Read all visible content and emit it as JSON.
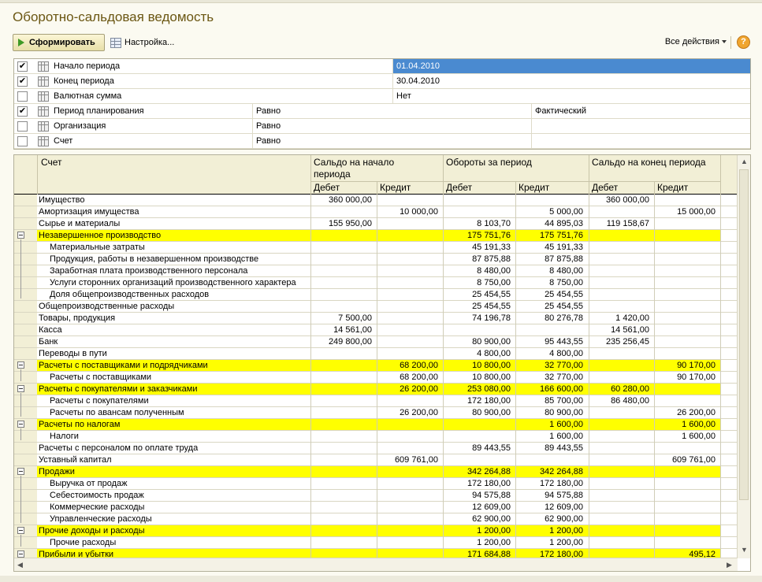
{
  "window": {
    "title": "Оборотно-сальдовая ведомость"
  },
  "toolbar": {
    "generate_label": "Сформировать",
    "settings_label": "Настройка...",
    "all_actions_label": "Все действия",
    "help_label": "?"
  },
  "settings": [
    {
      "checked": true,
      "name": "Начало периода",
      "condition": "",
      "value": "01.04.2010",
      "value2": ""
    },
    {
      "checked": true,
      "name": "Конец периода",
      "condition": "",
      "value": "30.04.2010",
      "value2": ""
    },
    {
      "checked": false,
      "name": "Валютная сумма",
      "condition": "",
      "value": "Нет",
      "value2": ""
    },
    {
      "checked": true,
      "name": "Период планирования",
      "condition": "Равно",
      "value": "",
      "value2": "Фактический"
    },
    {
      "checked": false,
      "name": "Организация",
      "condition": "Равно",
      "value": "",
      "value2": ""
    },
    {
      "checked": false,
      "name": "Счет",
      "condition": "Равно",
      "value": "",
      "value2": ""
    }
  ],
  "report": {
    "headers": {
      "account": "Счет",
      "opening": "Сальдо на начало периода",
      "turnover": "Обороты за период",
      "closing": "Сальдо на конец периода",
      "debit": "Дебет",
      "credit": "Кредит"
    },
    "rows": [
      {
        "name": "Имущество",
        "level": 0,
        "hl": false,
        "group": false,
        "v": [
          "360 000,00",
          "",
          "",
          "",
          "360 000,00",
          ""
        ]
      },
      {
        "name": "Амортизация имущества",
        "level": 0,
        "hl": false,
        "group": false,
        "v": [
          "",
          "10 000,00",
          "",
          "5 000,00",
          "",
          "15 000,00"
        ]
      },
      {
        "name": "Сырье и материалы",
        "level": 0,
        "hl": false,
        "group": false,
        "v": [
          "155 950,00",
          "",
          "8 103,70",
          "44 895,03",
          "119 158,67",
          ""
        ]
      },
      {
        "name": "Незавершенное производство",
        "level": 0,
        "hl": true,
        "group": true,
        "v": [
          "",
          "",
          "175 751,76",
          "175 751,76",
          "",
          ""
        ]
      },
      {
        "name": "Материальные затраты",
        "level": 1,
        "hl": false,
        "group": false,
        "v": [
          "",
          "",
          "45 191,33",
          "45 191,33",
          "",
          ""
        ]
      },
      {
        "name": "Продукция, работы в незавершенном производстве",
        "level": 1,
        "hl": false,
        "group": false,
        "v": [
          "",
          "",
          "87 875,88",
          "87 875,88",
          "",
          ""
        ]
      },
      {
        "name": "Заработная плата производственного персонала",
        "level": 1,
        "hl": false,
        "group": false,
        "v": [
          "",
          "",
          "8 480,00",
          "8 480,00",
          "",
          ""
        ]
      },
      {
        "name": "Услуги сторонних организаций производственного характера",
        "level": 1,
        "hl": false,
        "group": false,
        "v": [
          "",
          "",
          "8 750,00",
          "8 750,00",
          "",
          ""
        ]
      },
      {
        "name": "Доля общепроизводственных расходов",
        "level": 1,
        "hl": false,
        "group": false,
        "v": [
          "",
          "",
          "25 454,55",
          "25 454,55",
          "",
          ""
        ]
      },
      {
        "name": "Общепроизводственные расходы",
        "level": 0,
        "hl": false,
        "group": false,
        "v": [
          "",
          "",
          "25 454,55",
          "25 454,55",
          "",
          ""
        ]
      },
      {
        "name": "Товары, продукция",
        "level": 0,
        "hl": false,
        "group": false,
        "v": [
          "7 500,00",
          "",
          "74 196,78",
          "80 276,78",
          "1 420,00",
          ""
        ]
      },
      {
        "name": "Касса",
        "level": 0,
        "hl": false,
        "group": false,
        "v": [
          "14 561,00",
          "",
          "",
          "",
          "14 561,00",
          ""
        ]
      },
      {
        "name": "Банк",
        "level": 0,
        "hl": false,
        "group": false,
        "v": [
          "249 800,00",
          "",
          "80 900,00",
          "95 443,55",
          "235 256,45",
          ""
        ]
      },
      {
        "name": "Переводы в пути",
        "level": 0,
        "hl": false,
        "group": false,
        "v": [
          "",
          "",
          "4 800,00",
          "4 800,00",
          "",
          ""
        ]
      },
      {
        "name": "Расчеты с поставщиками и подрядчиками",
        "level": 0,
        "hl": true,
        "group": true,
        "v": [
          "",
          "68 200,00",
          "10 800,00",
          "32 770,00",
          "",
          "90 170,00"
        ]
      },
      {
        "name": "Расчеты с поставщиками",
        "level": 1,
        "hl": false,
        "group": false,
        "v": [
          "",
          "68 200,00",
          "10 800,00",
          "32 770,00",
          "",
          "90 170,00"
        ]
      },
      {
        "name": "Расчеты с покупателями и заказчиками",
        "level": 0,
        "hl": true,
        "group": true,
        "v": [
          "",
          "26 200,00",
          "253 080,00",
          "166 600,00",
          "60 280,00",
          ""
        ]
      },
      {
        "name": "Расчеты с покупателями",
        "level": 1,
        "hl": false,
        "group": false,
        "v": [
          "",
          "",
          "172 180,00",
          "85 700,00",
          "86 480,00",
          ""
        ]
      },
      {
        "name": "Расчеты по авансам полученным",
        "level": 1,
        "hl": false,
        "group": false,
        "v": [
          "",
          "26 200,00",
          "80 900,00",
          "80 900,00",
          "",
          "26 200,00"
        ]
      },
      {
        "name": "Расчеты по налогам",
        "level": 0,
        "hl": true,
        "group": true,
        "v": [
          "",
          "",
          "",
          "1 600,00",
          "",
          "1 600,00"
        ]
      },
      {
        "name": "Налоги",
        "level": 1,
        "hl": false,
        "group": false,
        "v": [
          "",
          "",
          "",
          "1 600,00",
          "",
          "1 600,00"
        ]
      },
      {
        "name": "Расчеты с персоналом по оплате труда",
        "level": 0,
        "hl": false,
        "group": false,
        "v": [
          "",
          "",
          "89 443,55",
          "89 443,55",
          "",
          ""
        ]
      },
      {
        "name": "Уставный капитал",
        "level": 0,
        "hl": false,
        "group": false,
        "v": [
          "",
          "609 761,00",
          "",
          "",
          "",
          "609 761,00"
        ]
      },
      {
        "name": "Продажи",
        "level": 0,
        "hl": true,
        "group": true,
        "v": [
          "",
          "",
          "342 264,88",
          "342 264,88",
          "",
          ""
        ]
      },
      {
        "name": "Выручка от продаж",
        "level": 1,
        "hl": false,
        "group": false,
        "v": [
          "",
          "",
          "172 180,00",
          "172 180,00",
          "",
          ""
        ]
      },
      {
        "name": "Себестоимость продаж",
        "level": 1,
        "hl": false,
        "group": false,
        "v": [
          "",
          "",
          "94 575,88",
          "94 575,88",
          "",
          ""
        ]
      },
      {
        "name": "Коммерческие расходы",
        "level": 1,
        "hl": false,
        "group": false,
        "v": [
          "",
          "",
          "12 609,00",
          "12 609,00",
          "",
          ""
        ]
      },
      {
        "name": "Управленческие расходы",
        "level": 1,
        "hl": false,
        "group": false,
        "v": [
          "",
          "",
          "62 900,00",
          "62 900,00",
          "",
          ""
        ]
      },
      {
        "name": "Прочие доходы и расходы",
        "level": 0,
        "hl": true,
        "group": true,
        "v": [
          "",
          "",
          "1 200,00",
          "1 200,00",
          "",
          ""
        ]
      },
      {
        "name": "Прочие расходы",
        "level": 1,
        "hl": false,
        "group": false,
        "v": [
          "",
          "",
          "1 200,00",
          "1 200,00",
          "",
          ""
        ]
      },
      {
        "name": "Прибыли и убытки",
        "level": 0,
        "hl": true,
        "group": true,
        "v": [
          "",
          "",
          "171 684,88",
          "172 180,00",
          "",
          "495,12"
        ]
      }
    ]
  }
}
